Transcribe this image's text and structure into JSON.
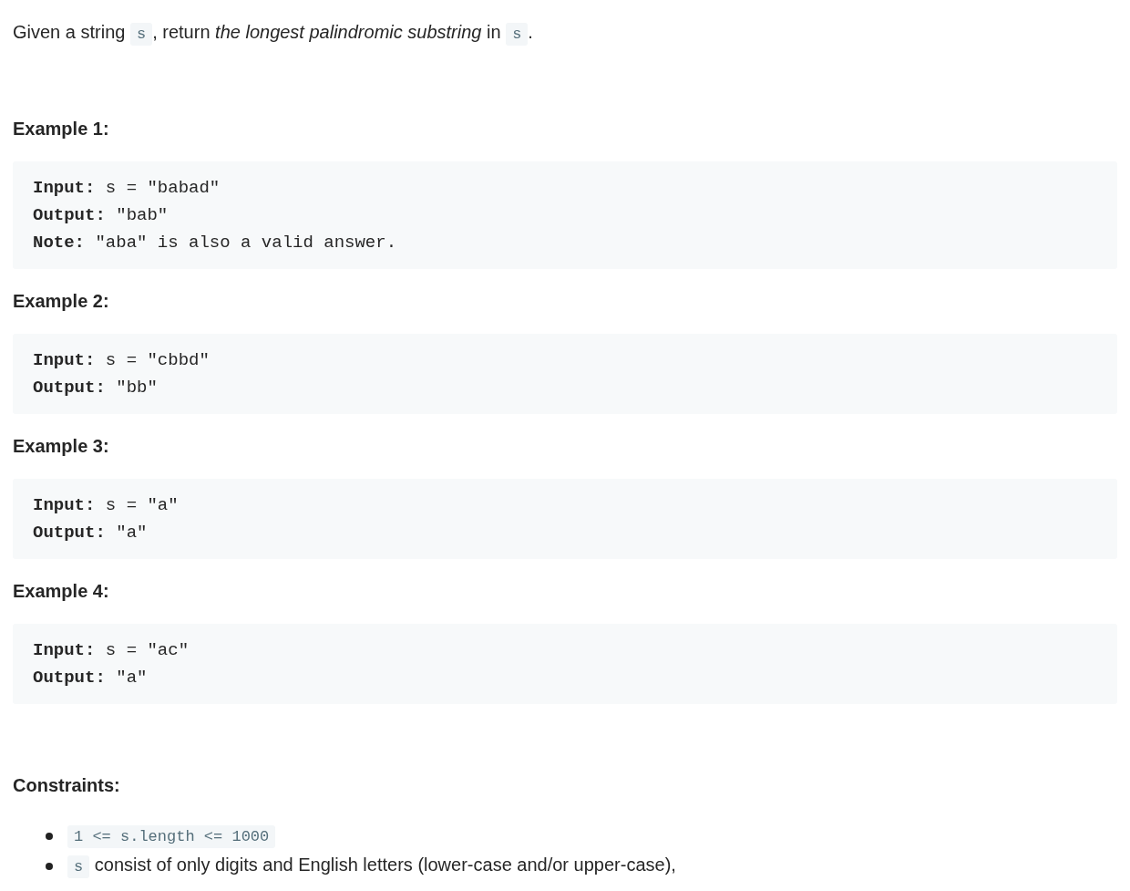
{
  "intro": [
    {
      "kind": "text",
      "text": "Given a string "
    },
    {
      "kind": "code",
      "text": "s"
    },
    {
      "kind": "text",
      "text": ", return *the longest palindromic substring* in "
    },
    {
      "kind": "code",
      "text": "s"
    },
    {
      "kind": "text",
      "text": "."
    }
  ],
  "examples": [
    {
      "title": "Example 1:",
      "lines": [
        {
          "label": "Input:",
          "value": "s = \"babad\""
        },
        {
          "label": "Output:",
          "value": "\"bab\""
        },
        {
          "label": "Note:",
          "value": "\"aba\" is also a valid answer."
        }
      ]
    },
    {
      "title": "Example 2:",
      "lines": [
        {
          "label": "Input:",
          "value": "s = \"cbbd\""
        },
        {
          "label": "Output:",
          "value": "\"bb\""
        }
      ]
    },
    {
      "title": "Example 3:",
      "lines": [
        {
          "label": "Input:",
          "value": "s = \"a\""
        },
        {
          "label": "Output:",
          "value": "\"a\""
        }
      ]
    },
    {
      "title": "Example 4:",
      "lines": [
        {
          "label": "Input:",
          "value": "s = \"ac\""
        },
        {
          "label": "Output:",
          "value": "\"a\""
        }
      ]
    }
  ],
  "constraints": {
    "title": "Constraints:",
    "items": [
      [
        {
          "kind": "code",
          "text": "1 <= s.length <= 1000"
        }
      ],
      [
        {
          "kind": "code",
          "text": "s"
        },
        {
          "kind": "text",
          "text": " consist of only digits and English letters (lower-case and/or upper-case),"
        }
      ]
    ]
  }
}
